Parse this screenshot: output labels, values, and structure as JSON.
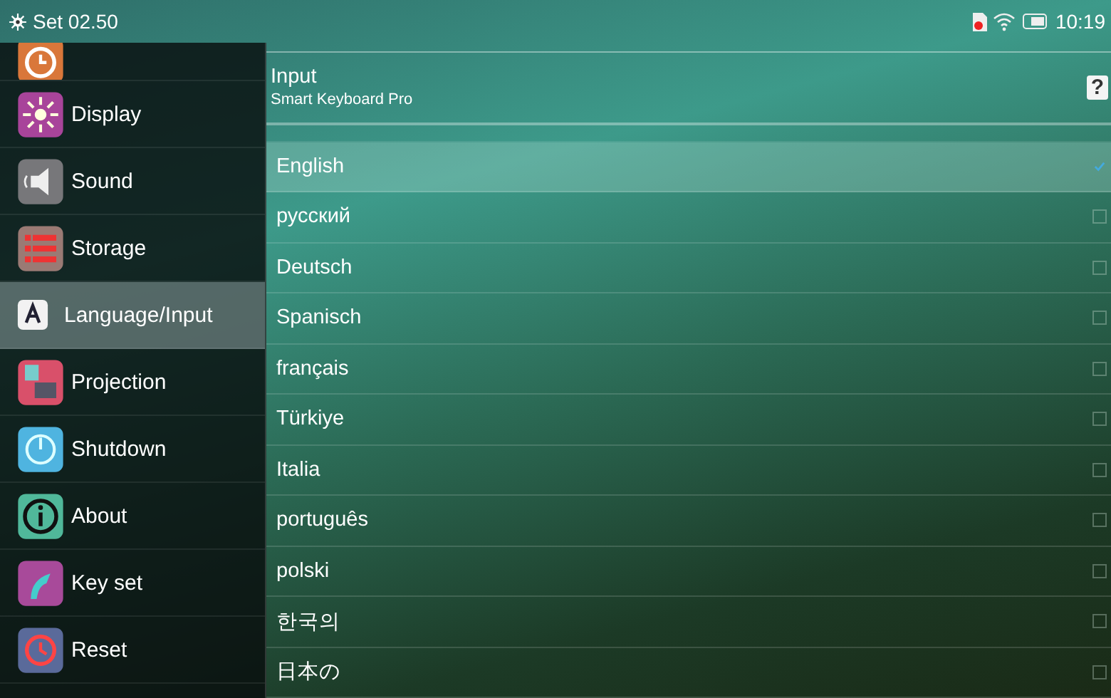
{
  "status_bar": {
    "title": "Set 02.50",
    "time": "10:19"
  },
  "sidebar": {
    "items": [
      {
        "selected": false
      },
      {
        "label": "Display",
        "selected": false
      },
      {
        "label": "Sound",
        "selected": false
      },
      {
        "label": "Storage",
        "selected": false
      },
      {
        "label": "Language/Input",
        "selected": true
      },
      {
        "label": "Projection",
        "selected": false
      },
      {
        "label": "Shutdown",
        "selected": false
      },
      {
        "label": "About",
        "selected": false
      },
      {
        "label": "Key set",
        "selected": false
      },
      {
        "label": "Reset",
        "selected": false
      }
    ]
  },
  "panel": {
    "title": "Input",
    "subtitle": "Smart Keyboard Pro",
    "help": "?"
  },
  "languages": [
    {
      "label": "English",
      "selected": true,
      "checked": true
    },
    {
      "label": "русский",
      "selected": false,
      "checked": false
    },
    {
      "label": "Deutsch",
      "selected": false,
      "checked": false
    },
    {
      "label": "Spanisch",
      "selected": false,
      "checked": false
    },
    {
      "label": "français",
      "selected": false,
      "checked": false
    },
    {
      "label": "Türkiye",
      "selected": false,
      "checked": false
    },
    {
      "label": "Italia",
      "selected": false,
      "checked": false
    },
    {
      "label": "português",
      "selected": false,
      "checked": false
    },
    {
      "label": "polski",
      "selected": false,
      "checked": false
    },
    {
      "label": "한국의",
      "selected": false,
      "checked": false
    },
    {
      "label": "日本の",
      "selected": false,
      "checked": false
    }
  ]
}
